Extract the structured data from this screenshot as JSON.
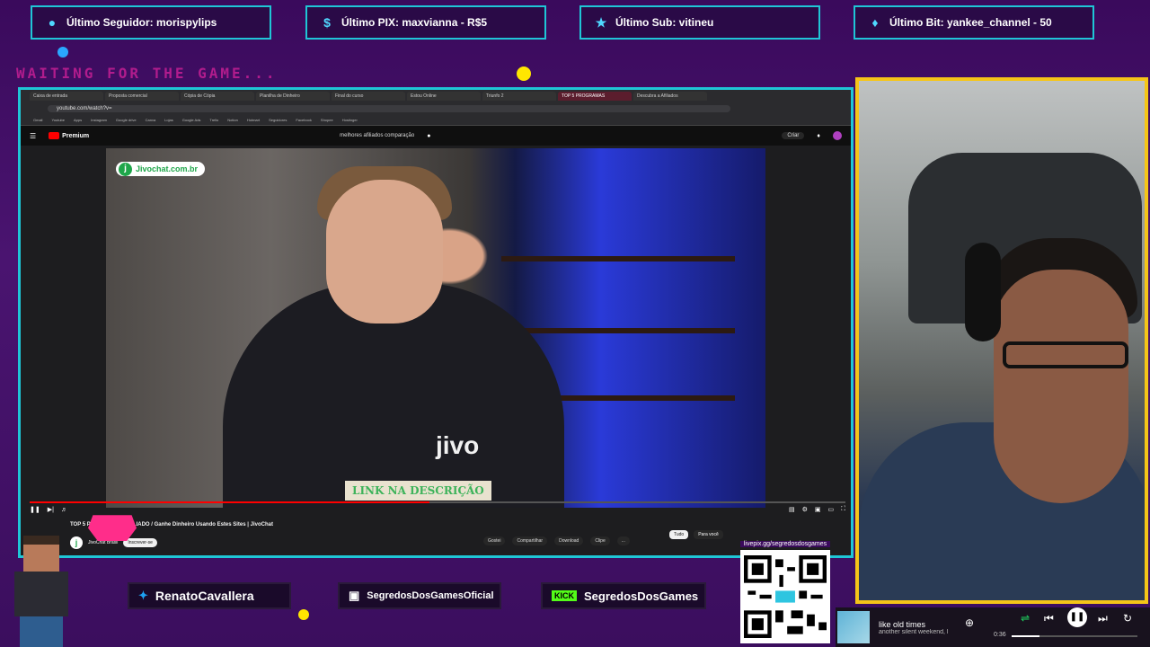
{
  "stats": {
    "follower": "Último Seguidor: morispylips",
    "pix": "Último PIX: maxvianna - R$5",
    "sub": "Último Sub: vitineu",
    "bit": "Último Bit: yankee_channel - 50"
  },
  "waiting_text": "WAITING FOR THE GAME...",
  "browser": {
    "tabs": [
      "Caixa de entrada",
      "Proposta comercial",
      "Cópia de Cópia",
      "Planilha de Dinheiro",
      "Final do curso",
      "Estou Online",
      "Triunfo 2",
      "TOP 5 PROGRAMAS",
      "Descubra a Afiliados"
    ],
    "url": "youtube.com/watch?v=",
    "bookmarks": [
      "Gmail",
      "Youtube",
      "Apps",
      "Instagram",
      "Google drive",
      "Canva",
      "Lojas",
      "Google Ads",
      "Trello",
      "Notion",
      "Hotmart",
      "Seguidores",
      "Facebook",
      "Shopee",
      "Hostinger"
    ],
    "yt_brand": "Premium",
    "search_text": "melhores afiliados comparação",
    "create_label": "Criar"
  },
  "video": {
    "badge": "Jivochat.com.br",
    "shirt_logo": "jivo",
    "overlay": "LINK NA DESCRIÇÃO",
    "progress": 0.49,
    "title": "TOP 5 Programas de AFILIADO / Ganhe Dinheiro Usando Estes Sites | JivoChat",
    "channel": "JivoChat Brasil",
    "subscribe": "Inscrever-se",
    "actions": [
      "Gostei",
      "Compartilhar",
      "Download",
      "Clipe",
      "..."
    ],
    "chips": [
      "Tudo",
      "Para você"
    ]
  },
  "socials": {
    "twitter": "RenatoCavallera",
    "instagram": "SegredosDosGamesOficial",
    "kick_badge": "KICK",
    "kick": "SegredosDosGames",
    "qr_label": "livepix.gg/segredosdosgames"
  },
  "player": {
    "title": "like old times",
    "artist": "another silent weekend, l",
    "time": "0:36",
    "progress": 0.22
  },
  "colors": {
    "frame": "#1fc6d6",
    "cam_border": "#f5c518",
    "background": "#3a0a5c",
    "accent_pink": "#b11c8d"
  }
}
